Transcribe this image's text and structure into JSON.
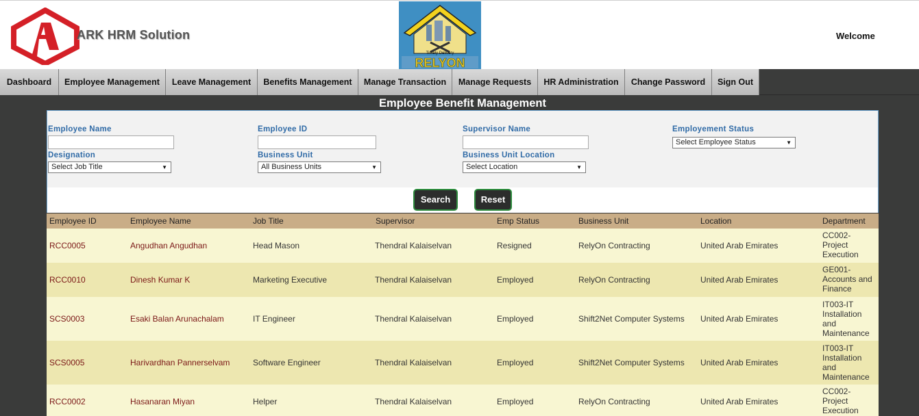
{
  "header": {
    "brand": "ARK HRM Solution",
    "center_logo_text": "RELYON",
    "center_logo_tagline": "Timely Delivery",
    "welcome": "Welcome"
  },
  "nav": {
    "items": [
      {
        "label": "Dashboard"
      },
      {
        "label": "Employee Management"
      },
      {
        "label": "Leave Management"
      },
      {
        "label": "Benefits Management"
      },
      {
        "label": "Manage Transaction"
      },
      {
        "label": "Manage Requests"
      },
      {
        "label": "HR Administration"
      },
      {
        "label": "Change Password"
      },
      {
        "label": "Sign Out"
      }
    ]
  },
  "page": {
    "title": "Employee Benefit Management"
  },
  "filters": {
    "employee_name": {
      "label": "Employee Name",
      "value": ""
    },
    "employee_id": {
      "label": "Employee ID",
      "value": ""
    },
    "supervisor_name": {
      "label": "Supervisor Name",
      "value": ""
    },
    "employment_status": {
      "label": "Employement Status",
      "selected": "Select Employee Status"
    },
    "designation": {
      "label": "Designation",
      "selected": "Select Job Title"
    },
    "business_unit": {
      "label": "Business Unit",
      "selected": "All Business Units"
    },
    "business_unit_location": {
      "label": "Business Unit Location",
      "selected": "Select Location"
    },
    "search_label": "Search",
    "reset_label": "Reset"
  },
  "table": {
    "columns": [
      "Employee ID",
      "Employee Name",
      "Job Title",
      "Supervisor",
      "Emp Status",
      "Business Unit",
      "Location",
      "Department"
    ],
    "rows": [
      {
        "id": "RCC0005",
        "name": "Angudhan Angudhan",
        "job": "Head Mason",
        "supervisor": "Thendral Kalaiselvan",
        "status": "Resigned",
        "unit": "RelyOn Contracting",
        "location": "United Arab Emirates",
        "dept": [
          "CC002-",
          "Project",
          "Execution"
        ]
      },
      {
        "id": "RCC0010",
        "name": "Dinesh Kumar K",
        "job": "Marketing Executive",
        "supervisor": "Thendral Kalaiselvan",
        "status": "Employed",
        "unit": "RelyOn Contracting",
        "location": "United Arab Emirates",
        "dept": [
          "GE001-",
          "Accounts and",
          "Finance"
        ]
      },
      {
        "id": "SCS0003",
        "name": "Esaki Balan Arunachalam",
        "job": "IT Engineer",
        "supervisor": "Thendral Kalaiselvan",
        "status": "Employed",
        "unit": "Shift2Net Computer Systems",
        "location": "United Arab Emirates",
        "dept": [
          "IT003-IT",
          "Installation",
          "and",
          "Maintenance"
        ]
      },
      {
        "id": "SCS0005",
        "name": "Harivardhan Pannerselvam",
        "job": "Software Engineer",
        "supervisor": "Thendral Kalaiselvan",
        "status": "Employed",
        "unit": "Shift2Net Computer Systems",
        "location": "United Arab Emirates",
        "dept": [
          "IT003-IT",
          "Installation",
          "and",
          "Maintenance"
        ]
      },
      {
        "id": "RCC0002",
        "name": "Hasanaran Miyan",
        "job": "Helper",
        "supervisor": "Thendral Kalaiselvan",
        "status": "Employed",
        "unit": "RelyOn Contracting",
        "location": "United Arab Emirates",
        "dept": [
          "CC002-",
          "Project",
          "Execution"
        ]
      }
    ]
  },
  "colors": {
    "header_row": "#c9ad87",
    "row_odd": "#f8f6d2",
    "row_even": "#ede7b0",
    "link_text": "#7a1616",
    "label_blue": "#2f6aa6",
    "logo_red": "#d42027"
  }
}
